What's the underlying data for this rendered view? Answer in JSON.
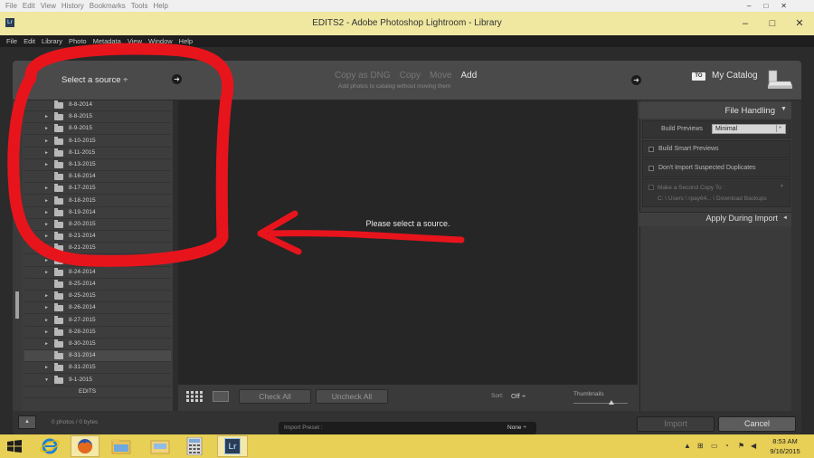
{
  "browser_menu": [
    "File",
    "Edit",
    "View",
    "History",
    "Bookmarks",
    "Tools",
    "Help"
  ],
  "window_controls_top": [
    "–",
    "□",
    "✕"
  ],
  "app": {
    "title": "EDITS2 - Adobe Photoshop Lightroom - Library",
    "logo": "Lr",
    "menu": [
      "File",
      "Edit",
      "Library",
      "Photo",
      "Metadata",
      "View",
      "Window",
      "Help"
    ],
    "window_controls": [
      "–",
      "□",
      "✕"
    ]
  },
  "import_dialog": {
    "source_label": "Select a source ÷",
    "modes": [
      "Copy as DNG",
      "Copy",
      "Move",
      "Add"
    ],
    "active_mode": "Add",
    "mode_subtitle": "Add photos to catalog without moving them",
    "to_badge": "TO",
    "destination": "My Catalog",
    "folders": [
      {
        "label": "8-8-2014",
        "arrow": ""
      },
      {
        "label": "8-8-2015",
        "arrow": "►"
      },
      {
        "label": "8-9-2015",
        "arrow": "►"
      },
      {
        "label": "8-10-2015",
        "arrow": "►"
      },
      {
        "label": "8-11-2015",
        "arrow": "►"
      },
      {
        "label": "8-13-2015",
        "arrow": "►"
      },
      {
        "label": "8-16-2014",
        "arrow": ""
      },
      {
        "label": "8-17-2015",
        "arrow": "►"
      },
      {
        "label": "8-18-2015",
        "arrow": "►"
      },
      {
        "label": "8-19-2014",
        "arrow": "►"
      },
      {
        "label": "8-20-2015",
        "arrow": "►"
      },
      {
        "label": "8-21-2014",
        "arrow": "►"
      },
      {
        "label": "8-21-2015",
        "arrow": "►"
      },
      {
        "label": "",
        "arrow": "►"
      },
      {
        "label": "8-24-2014",
        "arrow": "►"
      },
      {
        "label": "8-25-2014",
        "arrow": ""
      },
      {
        "label": "8-25-2015",
        "arrow": "►"
      },
      {
        "label": "8-26-2014",
        "arrow": "►"
      },
      {
        "label": "8-27-2015",
        "arrow": "►"
      },
      {
        "label": "8-28-2015",
        "arrow": "►"
      },
      {
        "label": "8-30-2015",
        "arrow": "►"
      },
      {
        "label": "8-31-2014",
        "arrow": ""
      },
      {
        "label": "8-31-2015",
        "arrow": "►"
      },
      {
        "label": "9-1-2015",
        "arrow": "▼"
      },
      {
        "label": "EDITS",
        "arrow": ""
      }
    ],
    "selected_folder_index": 21,
    "center_message": "Please select a source.",
    "check_all": "Check All",
    "uncheck_all": "Uncheck All",
    "sort_label": "Sort:",
    "sort_value": "Off ÷",
    "thumbnails_label": "Thumbnails",
    "thumbnail_size": 0.7,
    "file_handling": {
      "title": "File Handling",
      "build_previews_label": "Build Previews",
      "build_previews_value": "Minimal",
      "smart_previews": "Build Smart Previews",
      "no_duplicates": "Don't Import Suspected Duplicates",
      "second_copy": "Make a Second Copy To :",
      "second_copy_path": "C: \\ Users \\ rpay64... \\ Download Backups"
    },
    "apply_during_import": "Apply During Import",
    "photo_count": "0 photos / 0 bytes",
    "import_preset_label": "Import Preset :",
    "import_preset_value": "None ÷",
    "import_button": "Import",
    "cancel_button": "Cancel"
  },
  "taskbar": {
    "apps": [
      "start-icon",
      "internet-explorer-icon",
      "firefox-icon",
      "file-explorer-icon",
      "folder-icon",
      "calculator-icon",
      "lightroom-icon"
    ],
    "tray_time": "8:53 AM",
    "tray_date": "9/16/2015"
  },
  "annotation_color": "#e8141c"
}
